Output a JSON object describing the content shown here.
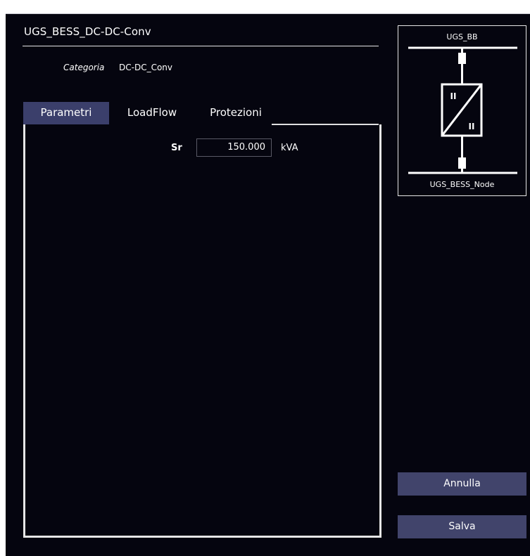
{
  "dialog": {
    "title": "UGS_BESS_DC-DC-Conv",
    "category_label": "Categoria",
    "category_value": "DC-DC_Conv"
  },
  "tabs": [
    {
      "label": "Parametri",
      "active": true
    },
    {
      "label": "LoadFlow",
      "active": false
    },
    {
      "label": "Protezioni",
      "active": false
    }
  ],
  "parameters": {
    "sr_label": "Sr",
    "sr_value": "150.000",
    "sr_unit": "kVA"
  },
  "diagram": {
    "top_bus": "UGS_BB",
    "bottom_bus": "UGS_BESS_Node",
    "converter_symbol": "dc-dc-converter-icon",
    "symbol_text": "II"
  },
  "buttons": {
    "annulla": "Annulla",
    "salva": "Salva"
  },
  "colors": {
    "background": "#05050f",
    "active_tab": "#3b3f6b",
    "button": "#41446b",
    "lines": "#e6e6e6"
  }
}
